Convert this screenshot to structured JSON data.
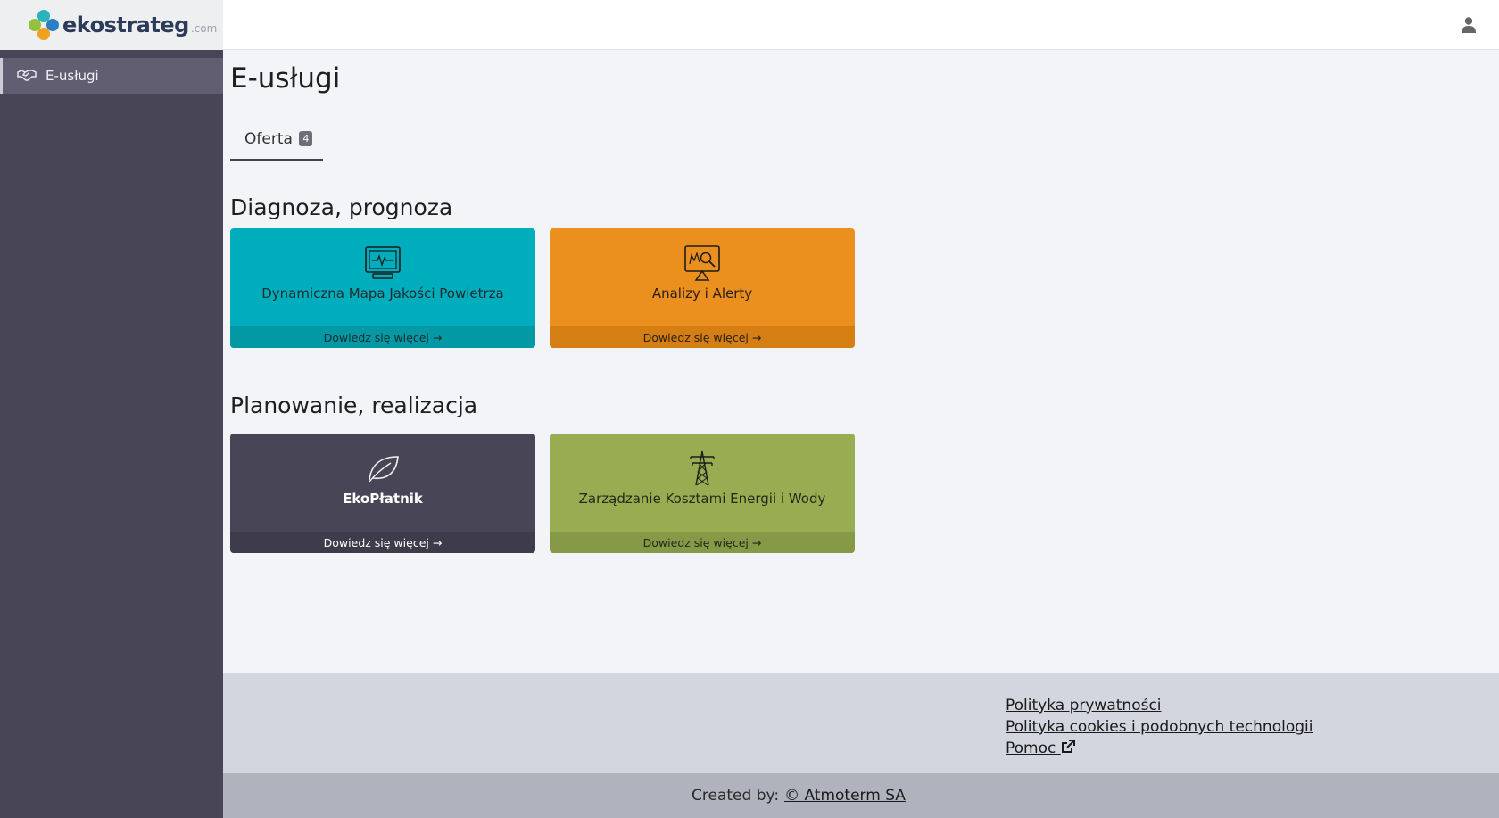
{
  "logo": {
    "name": "ekostrateg",
    "suffix": ".com"
  },
  "sidebar": {
    "items": [
      {
        "label": "E-usługi",
        "icon": "handshake-icon"
      }
    ]
  },
  "header": {
    "user_icon": "user-icon"
  },
  "main": {
    "title": "E-usługi",
    "tabs": [
      {
        "label": "Oferta",
        "count": "4"
      }
    ],
    "sections": [
      {
        "title": "Diagnoza, prognoza",
        "cards": [
          {
            "title": "Dynamiczna Mapa Jakości Powietrza",
            "link": "Dowiedz się więcej",
            "icon": "monitor-pulse-icon",
            "color": "#00adbc"
          },
          {
            "title": "Analizy i Alerty",
            "link": "Dowiedz się więcej",
            "icon": "monitor-chart-search-icon",
            "color": "#eb8f1e"
          }
        ]
      },
      {
        "title": "Planowanie, realizacja",
        "cards": [
          {
            "title": "EkoPłatnik",
            "link": "Dowiedz się więcej",
            "icon": "leaf-icon",
            "color": "#484656"
          },
          {
            "title": "Zarządzanie Kosztami Energii i Wody",
            "link": "Dowiedz się więcej",
            "icon": "power-tower-icon",
            "color": "#98ad51"
          }
        ]
      }
    ]
  },
  "footer": {
    "links": [
      "Polityka prywatności",
      "Polityka cookies i podobnych technologii",
      "Pomoc"
    ],
    "created_by_label": "Created by:",
    "created_by_link": "© Atmoterm SA"
  }
}
